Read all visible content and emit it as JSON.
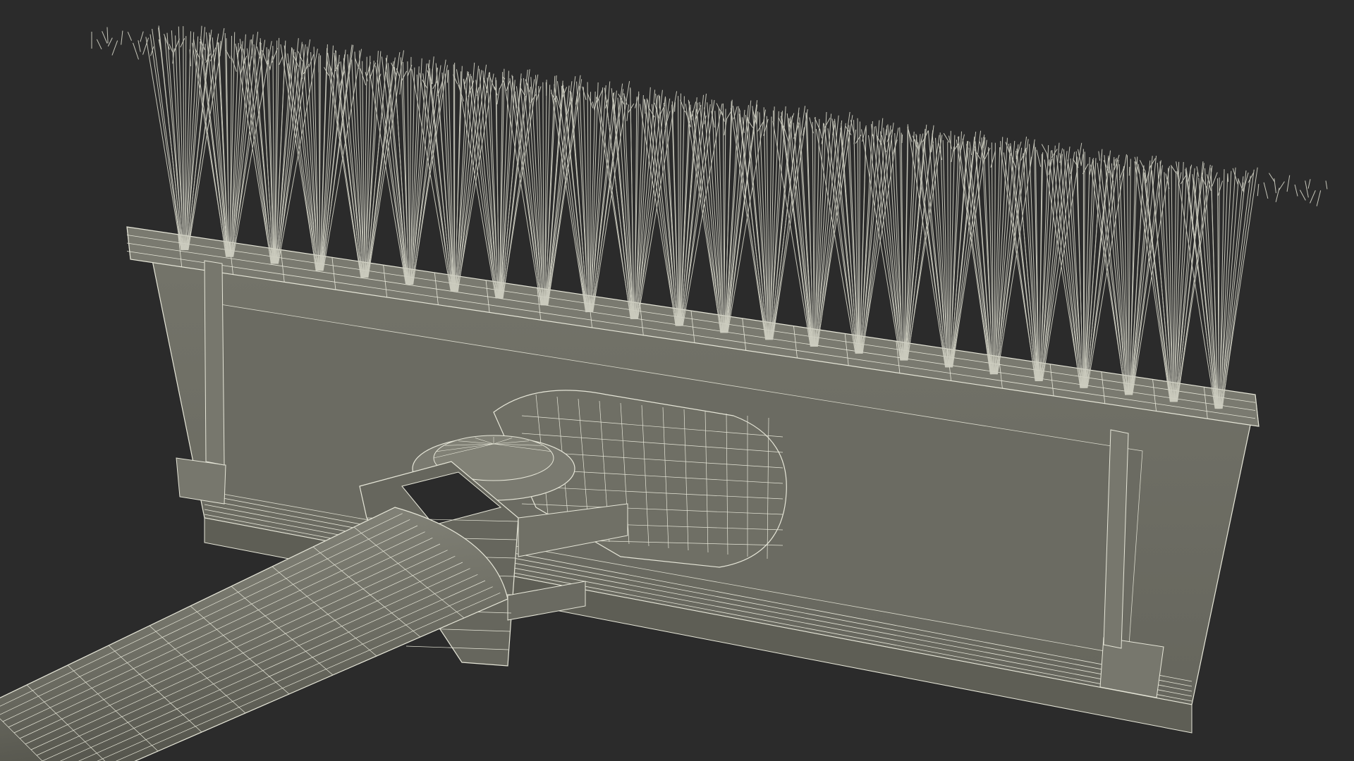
{
  "scene": {
    "subject": "",
    "render_style": "wireframe-over-clay",
    "colors": {
      "background": "#2b2b2b",
      "surface": "#6e6e64",
      "surface_dark": "#5a5a51",
      "surface_light": "#85857a",
      "wire": "#e6e6d8",
      "bristle": "#c9c9bc"
    },
    "parts": [
      "bristle-block",
      "brush-head",
      "handle-socket",
      "swivel-joint",
      "handle"
    ]
  }
}
